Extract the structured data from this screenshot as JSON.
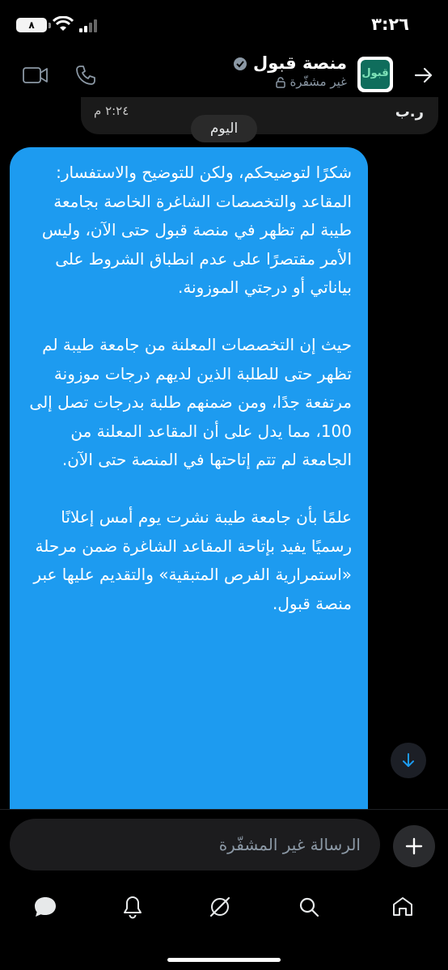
{
  "status_bar": {
    "time": "٣:٢٦",
    "battery": "٨"
  },
  "header": {
    "title": "منصة قبول",
    "subtitle": "غير مشفّرة",
    "avatar_text": "قبول"
  },
  "previous_message": {
    "sender": "ر.ب",
    "time": "٢:٢٤ م"
  },
  "date_chip": "اليوم",
  "message": {
    "text": "شكرًا لتوضيحكم، ولكن للتوضيح والاستفسار: المقاعد والتخصصات الشاغرة الخاصة بجامعة طيبة لم تظهر في منصة قبول حتى الآن، وليس الأمر مقتصرًا على عدم انطباق الشروط على بياناتي أو درجتي الموزونة.\n\nحيث إن التخصصات المعلنة من جامعة طيبة لم تظهر حتى للطلبة الذين لديهم درجات موزونة مرتفعة جدًا، ومن ضمنهم طلبة بدرجات تصل إلى 100، مما يدل على أن المقاعد المعلنة من الجامعة لم تتم إتاحتها في المنصة حتى الآن.\n\nعلمًا بأن جامعة طيبة نشرت يوم أمس إعلانًا رسميًا يفيد بإتاحة المقاعد الشاغرة ضمن مرحلة «استمرارية الفرص المتبقية» والتقديم عليها عبر منصة قبول."
  },
  "composer": {
    "placeholder": "الرسالة غير المشفّرة"
  },
  "colors": {
    "bubble": "#1d9bf0",
    "background": "#000000",
    "accent": "#1d9bf0"
  },
  "bottom_nav": [
    "chat-icon",
    "bell-icon",
    "grok-icon",
    "search-icon",
    "home-icon"
  ]
}
